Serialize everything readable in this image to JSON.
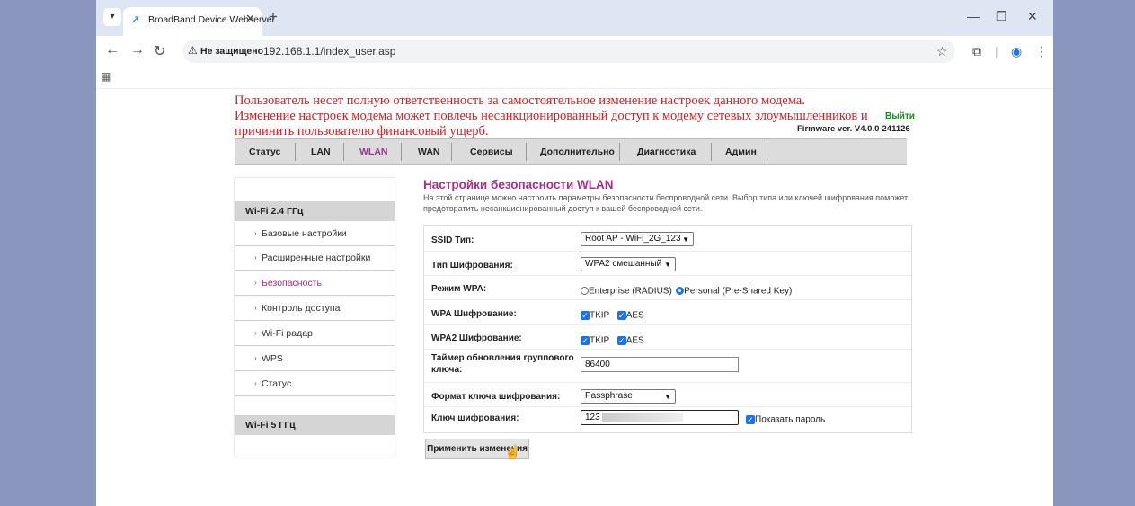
{
  "browser": {
    "tab_title": "BroadBand Device Webserver",
    "new_tab": "+",
    "security_label": "Не защищено",
    "url": "192.168.1.1/index_user.asp"
  },
  "warning": {
    "line1": "Пользователь несет полную ответственность за самостоятельное изменение настроек данного модема.",
    "line2": "Изменение настроек модема может повлечь несанкционированный доступ к модему сетевых злоумышленников и",
    "line3": "причинить пользователю финансовый ущерб."
  },
  "header": {
    "logout": "Выйти",
    "firmware": "Firmware ver. V4.0.0-241126"
  },
  "menu": {
    "items": [
      "Статус",
      "LAN",
      "WLAN",
      "WAN",
      "Сервисы",
      "Дополнительно",
      "Диагностика",
      "Админ"
    ],
    "active": "WLAN"
  },
  "sidebar": {
    "group1": "Wi-Fi 2.4 ГГц",
    "items": [
      "Базовые настройки",
      "Расширенные настройки",
      "Безопасность",
      "Контроль доступа",
      "Wi-Fi радар",
      "WPS",
      "Статус"
    ],
    "group2": "Wi-Fi 5 ГГц"
  },
  "content": {
    "title": "Настройки безопасности WLAN",
    "desc": "На этой странице можно настроить параметры безопасности беспроводной сети. Выбор типа или ключей шифрования поможет предотвратить несанкционированный доступ к вашей беспроводной сети."
  },
  "form": {
    "ssid_label": "SSID Тип:",
    "ssid_value": "Root AP - WiFi_2G_123",
    "enc_type_label": "Тип Шифрования:",
    "enc_type_value": "WPA2 смешанный",
    "wpa_mode_label": "Режим WPA:",
    "wpa_mode_opt1": "Enterprise (RADIUS)",
    "wpa_mode_opt2": "Personal (Pre-Shared Key)",
    "wpa_enc_label": "WPA Шифрование:",
    "wpa2_enc_label": "WPA2 Шифрование:",
    "tkip": "TKIP",
    "aes": "AES",
    "timer_label": "Таймер обновления группового ключа:",
    "timer_value": "86400",
    "key_format_label": "Формат ключа шифрования:",
    "key_format_value": "Passphrase",
    "key_label": "Ключ шифрования:",
    "key_value": "123",
    "show_password": "Показать пароль",
    "apply": "Применить изменения"
  }
}
